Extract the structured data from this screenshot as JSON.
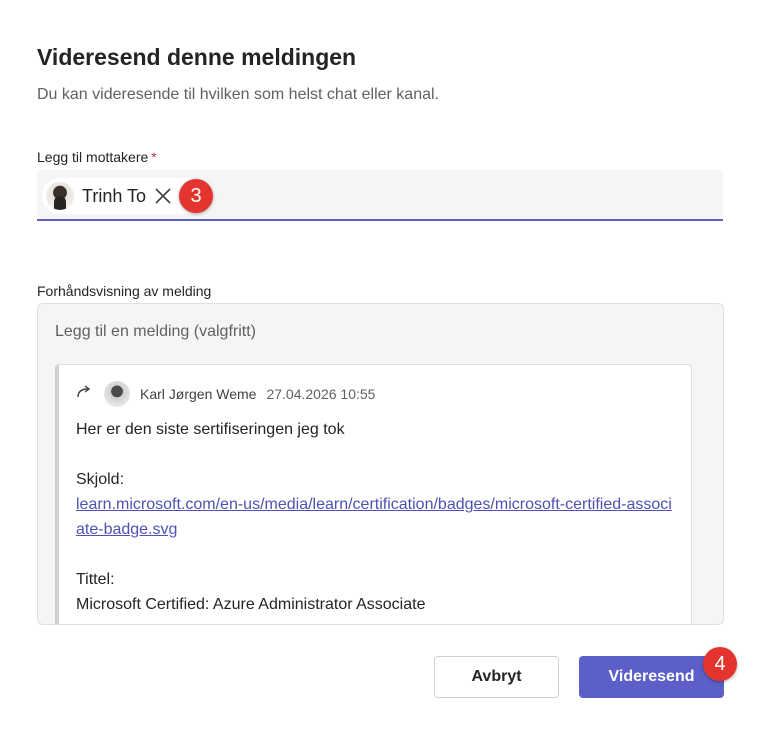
{
  "dialog": {
    "title": "Videresend denne meldingen",
    "subtitle": "Du kan videresende til hvilken som helst chat eller kanal."
  },
  "recipients": {
    "label": "Legg til mottakere",
    "required_marker": "*",
    "chips": [
      {
        "name": "Trinh To"
      }
    ]
  },
  "preview": {
    "label": "Forhåndsvisning av melding",
    "message_placeholder": "Legg til en melding (valgfritt)",
    "quoted": {
      "author": "Karl Jørgen Weme",
      "timestamp": "27.04.2026 10:55",
      "text_line": "Her er den siste sertifiseringen jeg tok",
      "badge_label": "Skjold:",
      "badge_link": "learn.microsoft.com/en-us/media/learn/certification/badges/microsoft-certified-associate-badge.svg",
      "title_label": "Tittel:",
      "title_value": "Microsoft Certified: Azure Administrator Associate"
    }
  },
  "annotations": {
    "step_recipient": "3",
    "step_send": "4"
  },
  "buttons": {
    "cancel": "Avbryt",
    "forward": "Videresend"
  },
  "colors": {
    "accent": "#5b5fc7",
    "link": "#4f52b2",
    "annotation_badge": "#e3352e"
  }
}
